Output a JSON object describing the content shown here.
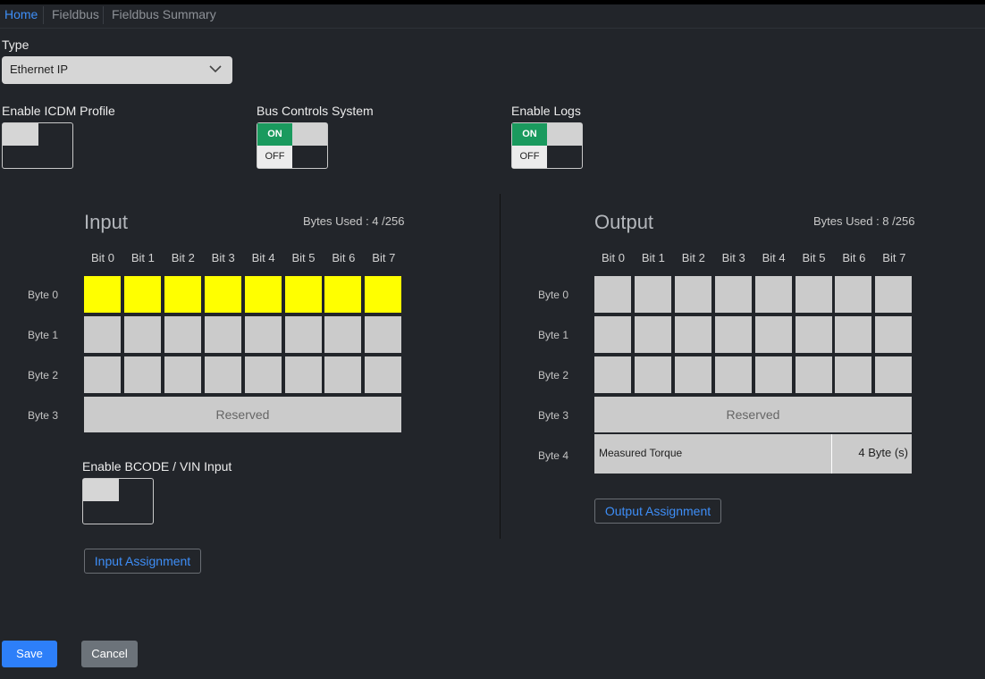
{
  "breadcrumb": [
    "Home",
    "Fieldbus",
    "Fieldbus Summary"
  ],
  "type_section": {
    "label": "Type",
    "selected": "Ethernet IP"
  },
  "toggles": {
    "icdm": {
      "label": "Enable ICDM Profile",
      "state": "off"
    },
    "bus_controls": {
      "label": "Bus Controls System",
      "on_label": "ON",
      "off_label": "OFF",
      "state": "on"
    },
    "logs": {
      "label": "Enable Logs",
      "on_label": "ON",
      "off_label": "OFF",
      "state": "on"
    },
    "bcode": {
      "label": "Enable BCODE / VIN Input",
      "state": "off"
    }
  },
  "input": {
    "title": "Input",
    "bytes_used": "Bytes Used : 4 /256",
    "bits": [
      "Bit 0",
      "Bit 1",
      "Bit 2",
      "Bit 3",
      "Bit 4",
      "Bit 5",
      "Bit 6",
      "Bit 7"
    ],
    "bytes": [
      "Byte 0",
      "Byte 1",
      "Byte 2",
      "Byte 3"
    ],
    "active_byte": "Byte 0",
    "active_color": "#ffff00",
    "reserved_label": "Reserved",
    "assignment_button": "Input Assignment"
  },
  "output": {
    "title": "Output",
    "bytes_used": "Bytes Used : 8 /256",
    "bits": [
      "Bit 0",
      "Bit 1",
      "Bit 2",
      "Bit 3",
      "Bit 4",
      "Bit 5",
      "Bit 6",
      "Bit 7"
    ],
    "bytes": [
      "Byte 0",
      "Byte 1",
      "Byte 2",
      "Byte 3",
      "Byte 4"
    ],
    "reserved_label": "Reserved",
    "torque_label": "Measured Torque",
    "torque_size": "4 Byte (s)",
    "assignment_button": "Output Assignment"
  },
  "actions": {
    "save": "Save",
    "cancel": "Cancel"
  },
  "colors": {
    "accent": "#3e8ef7",
    "toggle_on": "#1a9a5e",
    "save": "#2d7ff9",
    "cancel": "#6c737a"
  }
}
